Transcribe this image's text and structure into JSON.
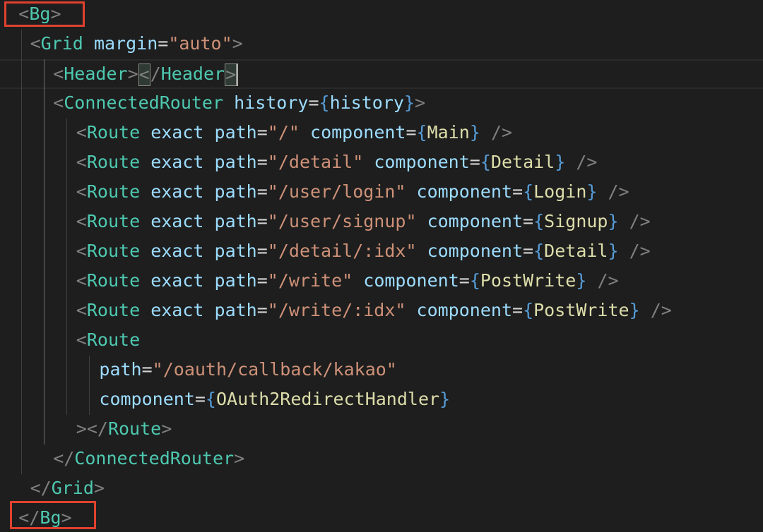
{
  "colors": {
    "background": "#1e1e1e",
    "punctuation": "#808080",
    "tag": "#4ec9b0",
    "attribute": "#9cdcfe",
    "string": "#ce9178",
    "brace": "#569cd6",
    "identifier": "#dcdcaa",
    "default": "#d4d4d4",
    "annotation_box": "#e0412f"
  },
  "code_lines": [
    {
      "indent": 1,
      "tokens": [
        {
          "t": "<",
          "c": "punctuation"
        },
        {
          "t": "Bg",
          "c": "tag"
        },
        {
          "t": ">",
          "c": "punctuation"
        }
      ]
    },
    {
      "indent": 2,
      "tokens": [
        {
          "t": "<",
          "c": "punctuation"
        },
        {
          "t": "Grid",
          "c": "tag"
        },
        {
          "t": " ",
          "c": "default"
        },
        {
          "t": "margin",
          "c": "attribute"
        },
        {
          "t": "=",
          "c": "default"
        },
        {
          "t": "\"auto\"",
          "c": "string"
        },
        {
          "t": ">",
          "c": "punctuation"
        }
      ]
    },
    {
      "indent": 4,
      "current": true,
      "tokens": [
        {
          "t": "<",
          "c": "punctuation"
        },
        {
          "t": "Header",
          "c": "tag"
        },
        {
          "t": ">",
          "c": "punctuation"
        },
        {
          "t": "<",
          "c": "punctuation",
          "match": true
        },
        {
          "t": "/",
          "c": "punctuation"
        },
        {
          "t": "Header",
          "c": "tag"
        },
        {
          "t": ">",
          "c": "punctuation",
          "match": true
        },
        {
          "t": "",
          "c": "default",
          "cursor": true
        }
      ]
    },
    {
      "indent": 4,
      "tokens": [
        {
          "t": "<",
          "c": "punctuation"
        },
        {
          "t": "ConnectedRouter",
          "c": "tag"
        },
        {
          "t": " ",
          "c": "default"
        },
        {
          "t": "history",
          "c": "attribute"
        },
        {
          "t": "=",
          "c": "default"
        },
        {
          "t": "{",
          "c": "brace"
        },
        {
          "t": "history",
          "c": "attribute"
        },
        {
          "t": "}",
          "c": "brace"
        },
        {
          "t": ">",
          "c": "punctuation"
        }
      ]
    },
    {
      "indent": 6,
      "tokens": [
        {
          "t": "<",
          "c": "punctuation"
        },
        {
          "t": "Route",
          "c": "tag"
        },
        {
          "t": " ",
          "c": "default"
        },
        {
          "t": "exact",
          "c": "attribute"
        },
        {
          "t": " ",
          "c": "default"
        },
        {
          "t": "path",
          "c": "attribute"
        },
        {
          "t": "=",
          "c": "default"
        },
        {
          "t": "\"/\"",
          "c": "string"
        },
        {
          "t": " ",
          "c": "default"
        },
        {
          "t": "component",
          "c": "attribute"
        },
        {
          "t": "=",
          "c": "default"
        },
        {
          "t": "{",
          "c": "brace"
        },
        {
          "t": "Main",
          "c": "identifier"
        },
        {
          "t": "}",
          "c": "brace"
        },
        {
          "t": " />",
          "c": "punctuation"
        }
      ]
    },
    {
      "indent": 6,
      "tokens": [
        {
          "t": "<",
          "c": "punctuation"
        },
        {
          "t": "Route",
          "c": "tag"
        },
        {
          "t": " ",
          "c": "default"
        },
        {
          "t": "exact",
          "c": "attribute"
        },
        {
          "t": " ",
          "c": "default"
        },
        {
          "t": "path",
          "c": "attribute"
        },
        {
          "t": "=",
          "c": "default"
        },
        {
          "t": "\"/detail\"",
          "c": "string"
        },
        {
          "t": " ",
          "c": "default"
        },
        {
          "t": "component",
          "c": "attribute"
        },
        {
          "t": "=",
          "c": "default"
        },
        {
          "t": "{",
          "c": "brace"
        },
        {
          "t": "Detail",
          "c": "identifier"
        },
        {
          "t": "}",
          "c": "brace"
        },
        {
          "t": " />",
          "c": "punctuation"
        }
      ]
    },
    {
      "indent": 6,
      "tokens": [
        {
          "t": "<",
          "c": "punctuation"
        },
        {
          "t": "Route",
          "c": "tag"
        },
        {
          "t": " ",
          "c": "default"
        },
        {
          "t": "exact",
          "c": "attribute"
        },
        {
          "t": " ",
          "c": "default"
        },
        {
          "t": "path",
          "c": "attribute"
        },
        {
          "t": "=",
          "c": "default"
        },
        {
          "t": "\"/user/login\"",
          "c": "string"
        },
        {
          "t": " ",
          "c": "default"
        },
        {
          "t": "component",
          "c": "attribute"
        },
        {
          "t": "=",
          "c": "default"
        },
        {
          "t": "{",
          "c": "brace"
        },
        {
          "t": "Login",
          "c": "identifier"
        },
        {
          "t": "}",
          "c": "brace"
        },
        {
          "t": " />",
          "c": "punctuation"
        }
      ]
    },
    {
      "indent": 6,
      "tokens": [
        {
          "t": "<",
          "c": "punctuation"
        },
        {
          "t": "Route",
          "c": "tag"
        },
        {
          "t": " ",
          "c": "default"
        },
        {
          "t": "exact",
          "c": "attribute"
        },
        {
          "t": " ",
          "c": "default"
        },
        {
          "t": "path",
          "c": "attribute"
        },
        {
          "t": "=",
          "c": "default"
        },
        {
          "t": "\"/user/signup\"",
          "c": "string"
        },
        {
          "t": " ",
          "c": "default"
        },
        {
          "t": "component",
          "c": "attribute"
        },
        {
          "t": "=",
          "c": "default"
        },
        {
          "t": "{",
          "c": "brace"
        },
        {
          "t": "Signup",
          "c": "identifier"
        },
        {
          "t": "}",
          "c": "brace"
        },
        {
          "t": " />",
          "c": "punctuation"
        }
      ]
    },
    {
      "indent": 6,
      "tokens": [
        {
          "t": "<",
          "c": "punctuation"
        },
        {
          "t": "Route",
          "c": "tag"
        },
        {
          "t": " ",
          "c": "default"
        },
        {
          "t": "exact",
          "c": "attribute"
        },
        {
          "t": " ",
          "c": "default"
        },
        {
          "t": "path",
          "c": "attribute"
        },
        {
          "t": "=",
          "c": "default"
        },
        {
          "t": "\"/detail/:idx\"",
          "c": "string"
        },
        {
          "t": " ",
          "c": "default"
        },
        {
          "t": "component",
          "c": "attribute"
        },
        {
          "t": "=",
          "c": "default"
        },
        {
          "t": "{",
          "c": "brace"
        },
        {
          "t": "Detail",
          "c": "identifier"
        },
        {
          "t": "}",
          "c": "brace"
        },
        {
          "t": " />",
          "c": "punctuation"
        }
      ]
    },
    {
      "indent": 6,
      "tokens": [
        {
          "t": "<",
          "c": "punctuation"
        },
        {
          "t": "Route",
          "c": "tag"
        },
        {
          "t": " ",
          "c": "default"
        },
        {
          "t": "exact",
          "c": "attribute"
        },
        {
          "t": " ",
          "c": "default"
        },
        {
          "t": "path",
          "c": "attribute"
        },
        {
          "t": "=",
          "c": "default"
        },
        {
          "t": "\"/write\"",
          "c": "string"
        },
        {
          "t": " ",
          "c": "default"
        },
        {
          "t": "component",
          "c": "attribute"
        },
        {
          "t": "=",
          "c": "default"
        },
        {
          "t": "{",
          "c": "brace"
        },
        {
          "t": "PostWrite",
          "c": "identifier"
        },
        {
          "t": "}",
          "c": "brace"
        },
        {
          "t": " />",
          "c": "punctuation"
        }
      ]
    },
    {
      "indent": 6,
      "tokens": [
        {
          "t": "<",
          "c": "punctuation"
        },
        {
          "t": "Route",
          "c": "tag"
        },
        {
          "t": " ",
          "c": "default"
        },
        {
          "t": "exact",
          "c": "attribute"
        },
        {
          "t": " ",
          "c": "default"
        },
        {
          "t": "path",
          "c": "attribute"
        },
        {
          "t": "=",
          "c": "default"
        },
        {
          "t": "\"/write/:idx\"",
          "c": "string"
        },
        {
          "t": " ",
          "c": "default"
        },
        {
          "t": "component",
          "c": "attribute"
        },
        {
          "t": "=",
          "c": "default"
        },
        {
          "t": "{",
          "c": "brace"
        },
        {
          "t": "PostWrite",
          "c": "identifier"
        },
        {
          "t": "}",
          "c": "brace"
        },
        {
          "t": " />",
          "c": "punctuation"
        }
      ]
    },
    {
      "indent": 6,
      "tokens": [
        {
          "t": "<",
          "c": "punctuation"
        },
        {
          "t": "Route",
          "c": "tag"
        }
      ]
    },
    {
      "indent": 8,
      "tokens": [
        {
          "t": "path",
          "c": "attribute"
        },
        {
          "t": "=",
          "c": "default"
        },
        {
          "t": "\"/oauth/callback/kakao\"",
          "c": "string"
        }
      ]
    },
    {
      "indent": 8,
      "tokens": [
        {
          "t": "component",
          "c": "attribute"
        },
        {
          "t": "=",
          "c": "default"
        },
        {
          "t": "{",
          "c": "brace"
        },
        {
          "t": "OAuth2RedirectHandler",
          "c": "identifier"
        },
        {
          "t": "}",
          "c": "brace"
        }
      ]
    },
    {
      "indent": 6,
      "tokens": [
        {
          "t": "></",
          "c": "punctuation"
        },
        {
          "t": "Route",
          "c": "tag"
        },
        {
          "t": ">",
          "c": "punctuation"
        }
      ]
    },
    {
      "indent": 4,
      "tokens": [
        {
          "t": "</",
          "c": "punctuation"
        },
        {
          "t": "ConnectedRouter",
          "c": "tag"
        },
        {
          "t": ">",
          "c": "punctuation"
        }
      ]
    },
    {
      "indent": 2,
      "tokens": [
        {
          "t": "</",
          "c": "punctuation"
        },
        {
          "t": "Grid",
          "c": "tag"
        },
        {
          "t": ">",
          "c": "punctuation"
        }
      ]
    },
    {
      "indent": 1,
      "tokens": [
        {
          "t": "</",
          "c": "punctuation"
        },
        {
          "t": "Bg",
          "c": "tag"
        },
        {
          "t": ">",
          "c": "punctuation"
        }
      ]
    }
  ]
}
